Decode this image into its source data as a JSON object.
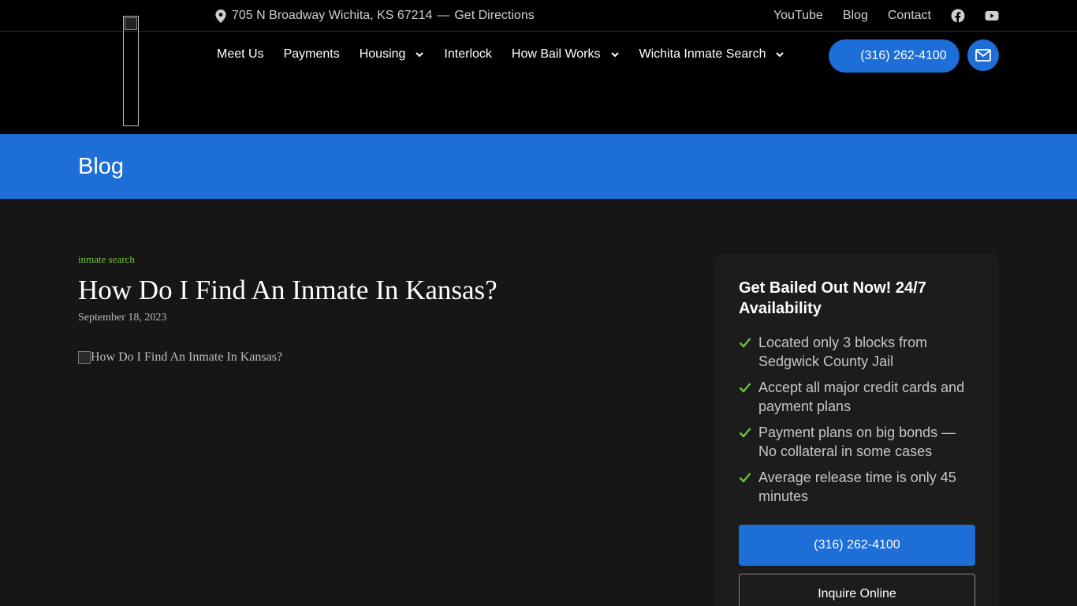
{
  "topbar": {
    "address": "705 N Broadway Wichita, KS 67214",
    "separator": "—",
    "directions": "Get Directions",
    "links": [
      "YouTube",
      "Blog",
      "Contact"
    ]
  },
  "nav": {
    "items": [
      {
        "label": "Meet Us",
        "dropdown": false
      },
      {
        "label": "Payments",
        "dropdown": false
      },
      {
        "label": "Housing",
        "dropdown": true
      },
      {
        "label": "Interlock",
        "dropdown": false
      },
      {
        "label": "How Bail Works",
        "dropdown": true
      },
      {
        "label": "Wichita Inmate Search",
        "dropdown": true
      }
    ],
    "phone": "(316) 262-4100"
  },
  "banner": {
    "title": "Blog"
  },
  "post": {
    "category": "inmate search",
    "title": "How Do I Find An Inmate In Kansas?",
    "date": "September 18, 2023",
    "image_alt": "How Do I Find An Inmate In Kansas?"
  },
  "sidebar": {
    "heading": "Get Bailed Out Now! 24/7 Availability",
    "checks": [
      "Located only 3 blocks from Sedgwick County Jail",
      "Accept all major credit cards and payment plans",
      "Payment plans on big bonds — No collateral in some cases",
      "Average release time is only 45 minutes"
    ],
    "phone_button": "(316) 262-4100",
    "inquire_button": "Inquire Online"
  },
  "colors": {
    "accent": "#1d6ed7",
    "check": "#6cc435",
    "background": "#161616"
  },
  "icons": [
    "map-pin-icon",
    "facebook-icon",
    "youtube-icon",
    "chevron-down-icon",
    "phone-icon",
    "mail-icon",
    "check-icon"
  ]
}
